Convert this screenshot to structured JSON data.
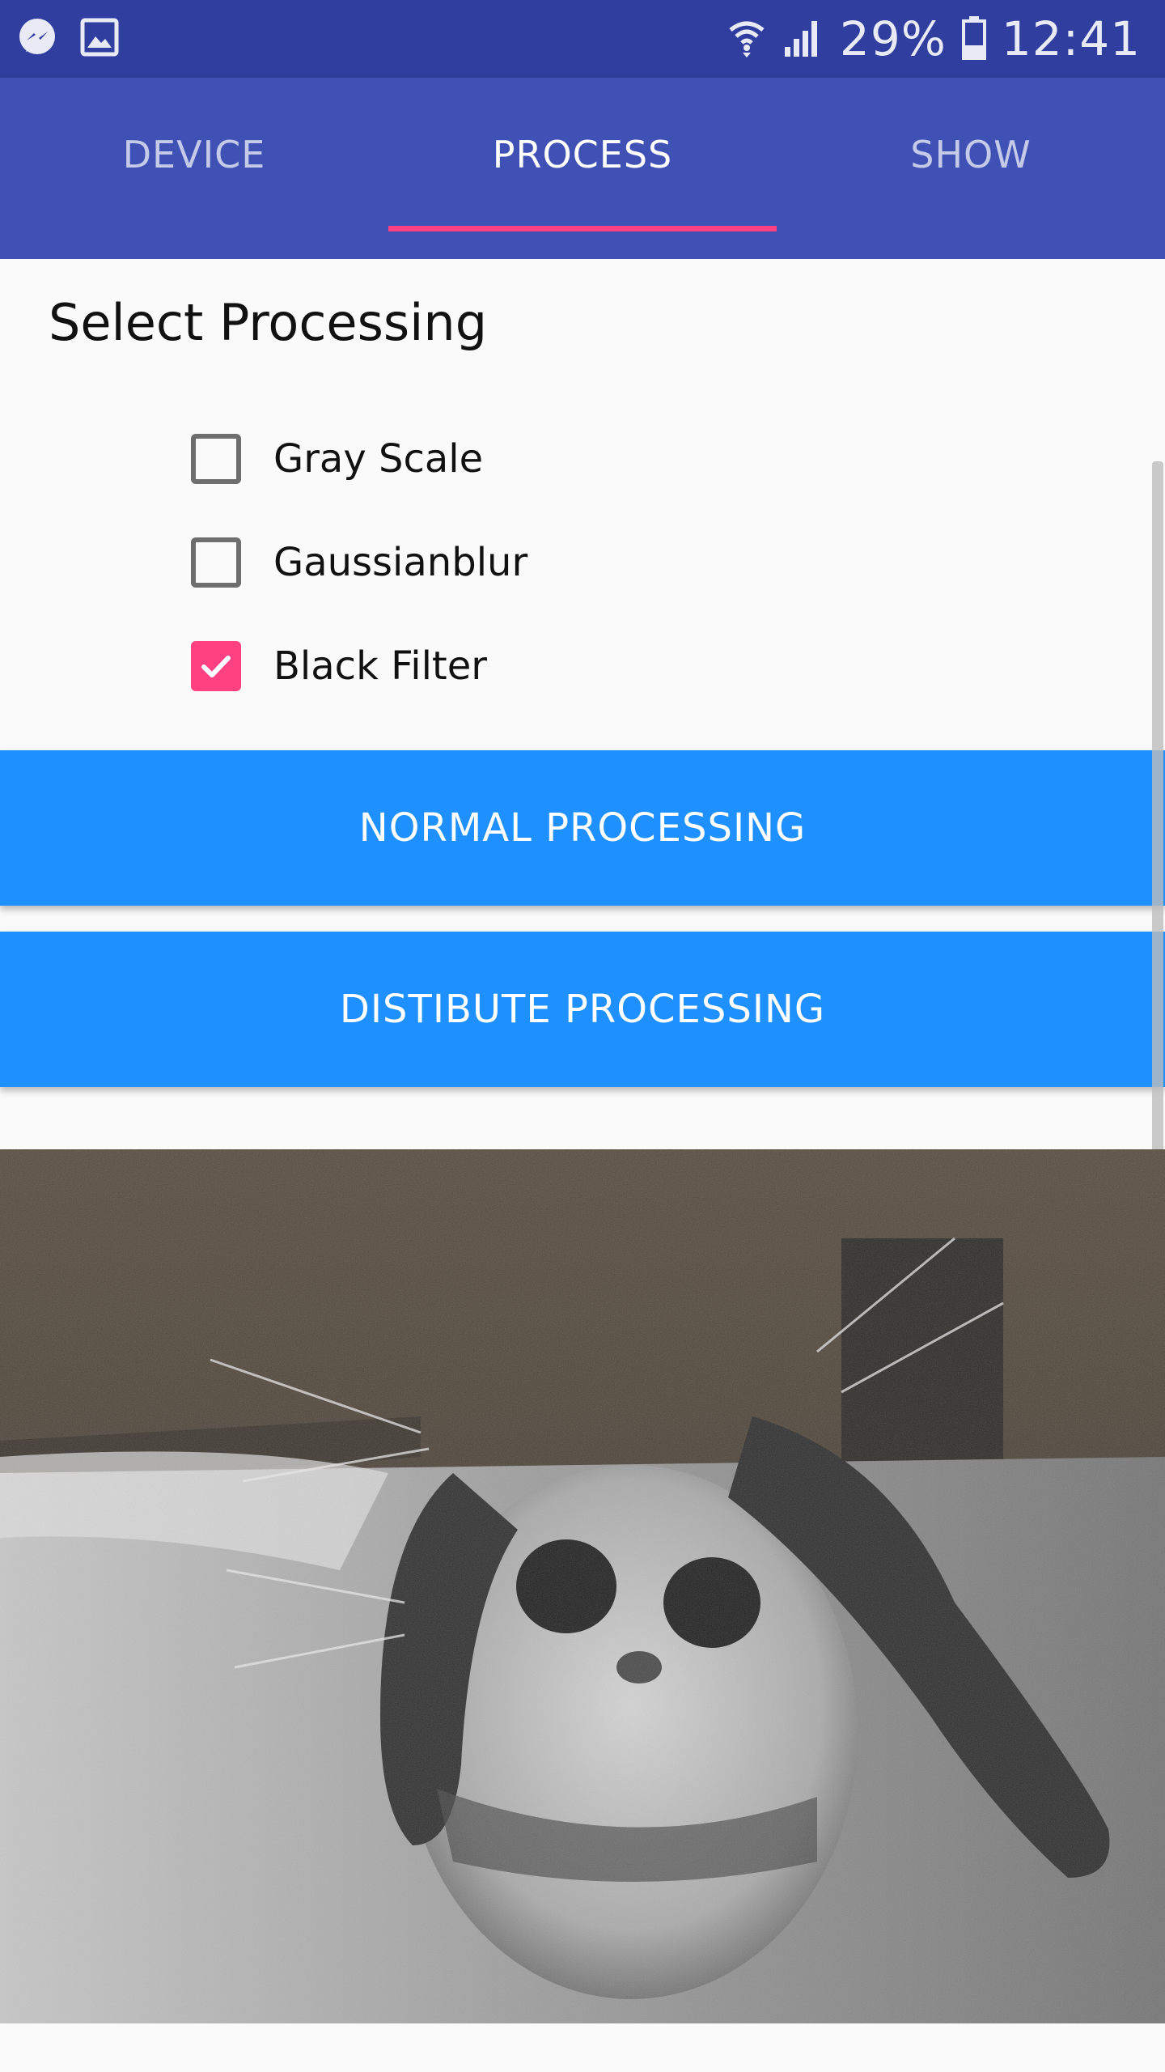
{
  "status_bar": {
    "left_icons": [
      "messenger-icon",
      "gallery-icon"
    ],
    "battery": "29%",
    "time": "12:41",
    "right_icons": [
      "wifi-icon",
      "signal-icon",
      "battery-icon"
    ]
  },
  "tabs": [
    {
      "label": "DEVICE"
    },
    {
      "label": "PROCESS"
    },
    {
      "label": "SHOW"
    }
  ],
  "active_tab": "PROCESS",
  "section_title": "Select Processing",
  "options": [
    {
      "label": "Gray Scale",
      "checked": false
    },
    {
      "label": "Gaussianblur",
      "checked": false
    },
    {
      "label": "Black Filter",
      "checked": true
    }
  ],
  "buttons": {
    "normal": "NORMAL PROCESSING",
    "distribute": "DISTIBUTE PROCESSING"
  },
  "colors": {
    "status_bar": "#303f9f",
    "app_bar": "#3f51b5",
    "accent": "#ff4081",
    "button": "#1e90ff"
  }
}
